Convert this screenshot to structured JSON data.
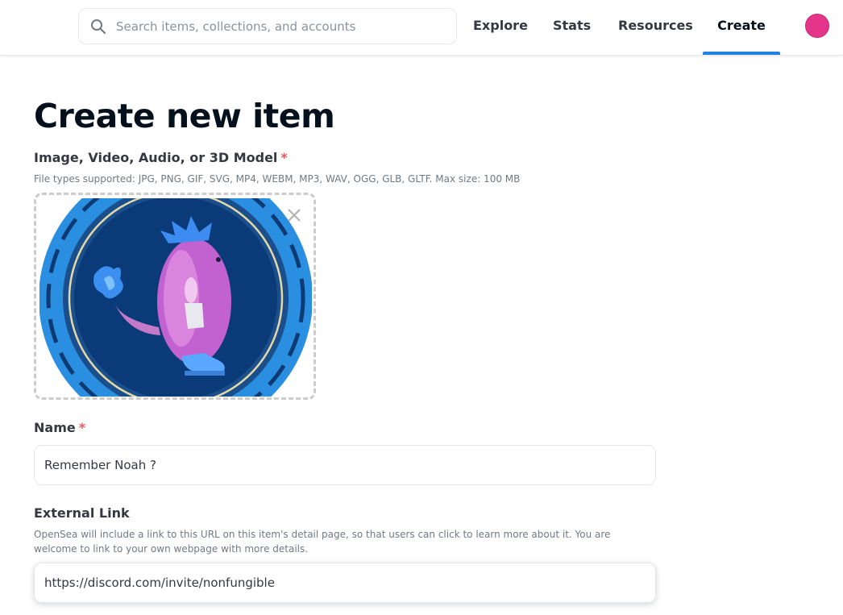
{
  "header": {
    "search": {
      "placeholder": "Search items, collections, and accounts",
      "value": ""
    },
    "nav": [
      {
        "label": "Explore"
      },
      {
        "label": "Stats"
      },
      {
        "label": "Resources"
      },
      {
        "label": "Create",
        "active": true
      }
    ],
    "accent_color": "#2081e2",
    "avatar_color": "#e5358a"
  },
  "form": {
    "title": "Create new item",
    "media": {
      "label": "Image, Video, Audio, or 3D Model",
      "required_mark": "*",
      "hint": "File types supported: JPG, PNG, GIF, SVG, MP4, WEBM, MP3, WAV, OGG, GLB, GLTF. Max size: 100 MB"
    },
    "name": {
      "label": "Name",
      "required_mark": "*",
      "value": "Remember Noah ?"
    },
    "external_link": {
      "label": "External Link",
      "hint": "OpenSea will include a link to this URL on this item's detail page, so that users can click to learn more about it. You are welcome to link to your own webpage with more details.",
      "value": "https://discord.com/invite/nonfungible"
    }
  }
}
